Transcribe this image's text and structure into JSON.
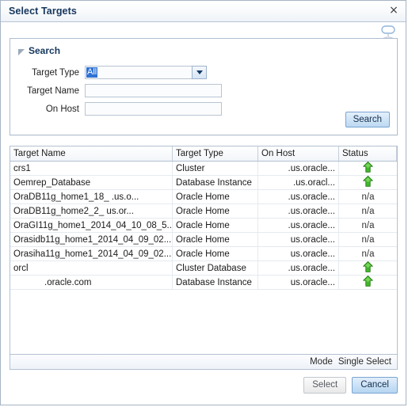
{
  "window": {
    "title": "Select Targets",
    "close_label": "×",
    "help_icon": "screen-tip-icon"
  },
  "search": {
    "title": "Search",
    "disclosure_icon": "disclosure-triangle-icon",
    "fields": [
      {
        "label": "Target Type",
        "value": "All",
        "placeholder": "",
        "type": "select",
        "name": "target-type"
      },
      {
        "label": "Target Name",
        "value": "",
        "placeholder": "",
        "type": "text",
        "name": "target-name"
      },
      {
        "label": "On Host",
        "value": "",
        "placeholder": "",
        "type": "text",
        "name": "on-host"
      }
    ],
    "search_button": "Search",
    "dropdown_icon": "chevron-down-icon"
  },
  "table": {
    "columns": [
      "Target Name",
      "Target Type",
      "On Host",
      "Status"
    ],
    "rows": [
      {
        "name": "crs1",
        "type": "Cluster",
        "host": ".us.oracle...",
        "status": "up",
        "indent": false
      },
      {
        "name": "Oemrep_Database",
        "type": "Database Instance",
        "host": ".us.oracl...",
        "status": "up",
        "indent": false
      },
      {
        "name": "OraDB11g_home1_18_          .us.o...",
        "type": "Oracle Home",
        "host": ".us.oracle...",
        "status": "n/a",
        "indent": false
      },
      {
        "name": "OraDB11g_home2_2_         us.or...",
        "type": "Oracle Home",
        "host": ".us.oracle...",
        "status": "n/a",
        "indent": false
      },
      {
        "name": "OraGI11g_home1_2014_04_10_08_5...",
        "type": "Oracle Home",
        "host": ".us.oracle...",
        "status": "n/a",
        "indent": false
      },
      {
        "name": "Orasidb11g_home1_2014_04_09_02...",
        "type": "Oracle Home",
        "host": "us.oracle...",
        "status": "n/a",
        "indent": false
      },
      {
        "name": "Orasiha11g_home1_2014_04_09_02...",
        "type": "Oracle Home",
        "host": "us.oracle...",
        "status": "n/a",
        "indent": false
      },
      {
        "name": "orcl",
        "type": "Cluster Database",
        "host": ".us.oracle...",
        "status": "up",
        "indent": false
      },
      {
        "name": ".oracle.com",
        "type": "Database Instance",
        "host": "us.oracle...",
        "status": "up",
        "indent": true
      }
    ],
    "status_up_icon": "green-up-arrow-icon",
    "status_na_label": "n/a"
  },
  "mode": {
    "label": "Mode",
    "value": "Single Select"
  },
  "actions": {
    "select_label": "Select",
    "cancel_label": "Cancel"
  },
  "colors": {
    "title": "#15365c",
    "accent_blue": "#2f72d4",
    "status_green": "#3fae2a",
    "panel_border": "#aebdd0"
  }
}
